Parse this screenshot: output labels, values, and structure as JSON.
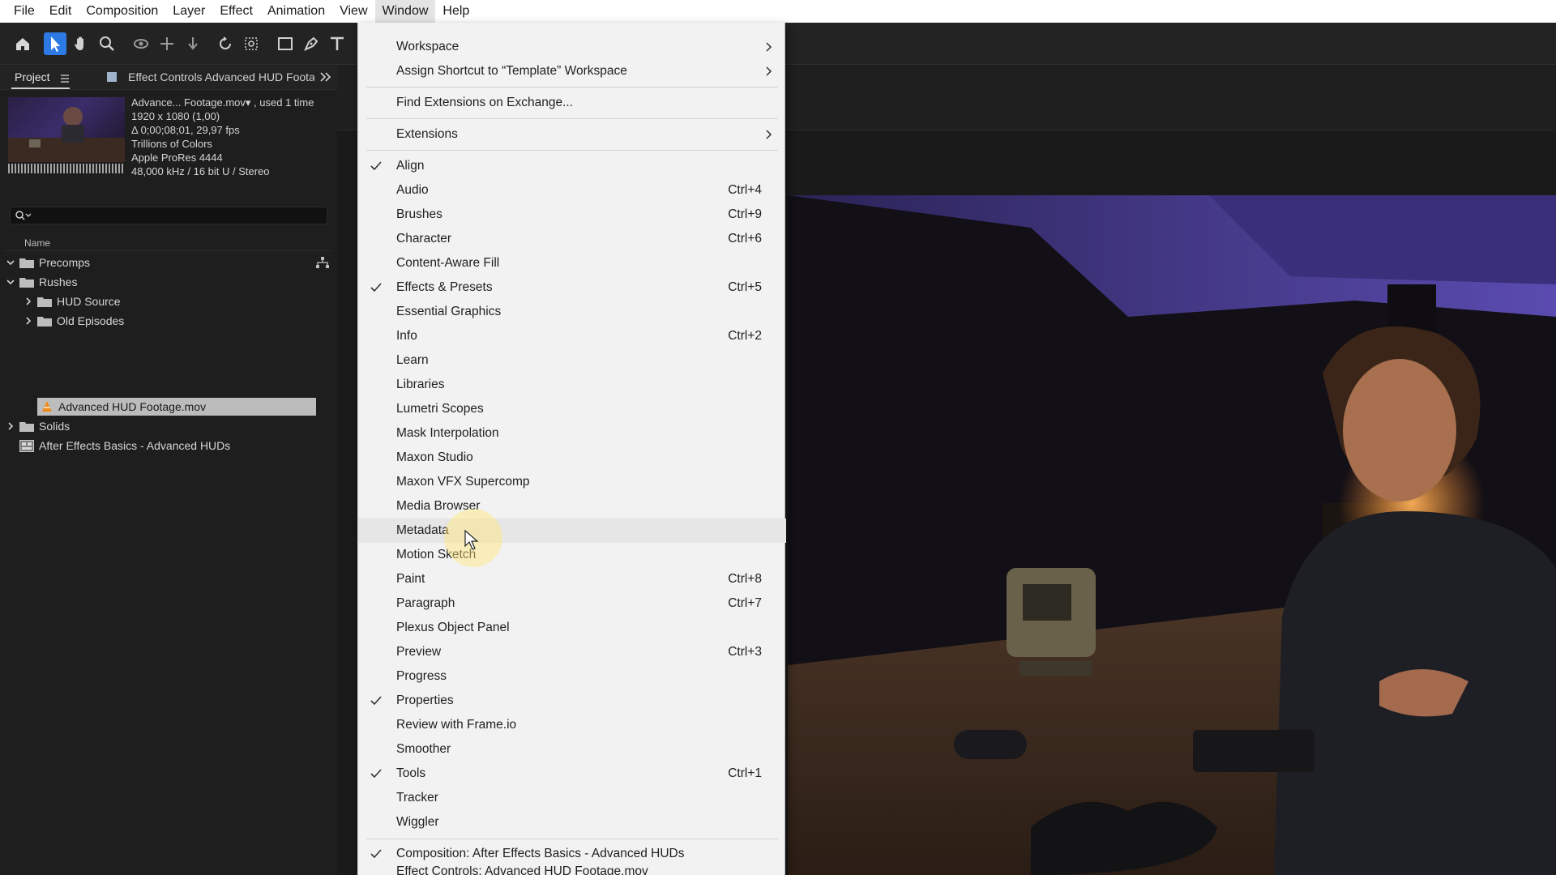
{
  "menubar": {
    "items": [
      "File",
      "Edit",
      "Composition",
      "Layer",
      "Effect",
      "Animation",
      "View",
      "Window",
      "Help"
    ]
  },
  "project_panel": {
    "tab_project": "Project",
    "tab_effect_controls": "Effect Controls Advanced HUD Footag",
    "footage_name": "Advance... Footage.mov▾ , used 1 time",
    "meta": [
      "1920 x 1080 (1,00)",
      "Δ 0;00;08;01, 29,97 fps",
      "Trillions of Colors",
      "Apple ProRes 4444",
      "48,000 kHz / 16 bit U / Stereo"
    ],
    "column_name": "Name",
    "tree": [
      {
        "label": "Precomps"
      },
      {
        "label": "Rushes"
      },
      {
        "label": "HUD Source"
      },
      {
        "label": "Old Episodes"
      },
      {
        "label": "Advanced HUD Footage.mov"
      },
      {
        "label": "Solids"
      },
      {
        "label": "After Effects Basics - Advanced HUDs"
      }
    ]
  },
  "window_menu": {
    "items": [
      {
        "label": "Workspace"
      },
      {
        "label": "Assign Shortcut to “Template” Workspace"
      },
      {
        "label": "Find Extensions on Exchange..."
      },
      {
        "label": "Extensions"
      },
      {
        "label": "Align"
      },
      {
        "label": "Audio",
        "shortcut": "Ctrl+4"
      },
      {
        "label": "Brushes",
        "shortcut": "Ctrl+9"
      },
      {
        "label": "Character",
        "shortcut": "Ctrl+6"
      },
      {
        "label": "Content-Aware Fill"
      },
      {
        "label": "Effects & Presets",
        "shortcut": "Ctrl+5"
      },
      {
        "label": "Essential Graphics"
      },
      {
        "label": "Info",
        "shortcut": "Ctrl+2"
      },
      {
        "label": "Learn"
      },
      {
        "label": "Libraries"
      },
      {
        "label": "Lumetri Scopes"
      },
      {
        "label": "Mask Interpolation"
      },
      {
        "label": "Maxon Studio"
      },
      {
        "label": "Maxon VFX Supercomp"
      },
      {
        "label": "Media Browser"
      },
      {
        "label": "Metadata"
      },
      {
        "label": "Motion Sketch"
      },
      {
        "label": "Paint",
        "shortcut": "Ctrl+8"
      },
      {
        "label": "Paragraph",
        "shortcut": "Ctrl+7"
      },
      {
        "label": "Plexus Object Panel"
      },
      {
        "label": "Preview",
        "shortcut": "Ctrl+3"
      },
      {
        "label": "Progress"
      },
      {
        "label": "Properties"
      },
      {
        "label": "Review with Frame.io"
      },
      {
        "label": "Smoother"
      },
      {
        "label": "Tools",
        "shortcut": "Ctrl+1"
      },
      {
        "label": "Tracker"
      },
      {
        "label": "Wiggler"
      },
      {
        "label": "Composition: After Effects Basics - Advanced HUDs"
      },
      {
        "label": "Effect Controls: Advanced HUD Footage.mov"
      }
    ]
  },
  "colors": {
    "accent": "#2d7ae6",
    "menu_bg": "#f2f2f2",
    "panel_bg": "#1e1e1e",
    "selected_row": "#bcbcbc"
  }
}
